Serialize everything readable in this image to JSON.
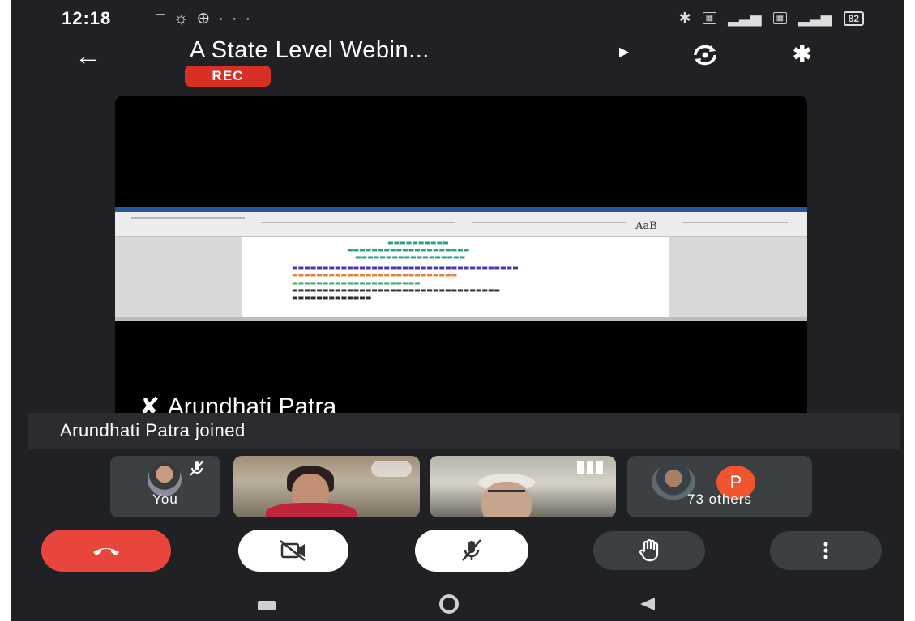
{
  "status_bar": {
    "time": "12:18",
    "battery": "82"
  },
  "header": {
    "title": "A State Level Webin...",
    "rec_label": "REC"
  },
  "video": {
    "speaker_name": "Arundhati Patra"
  },
  "toast": {
    "message": "Arundhati Patra joined"
  },
  "participants": {
    "self_label": "You",
    "others_label": "73 others",
    "others_avatar_letter": "P"
  },
  "controls": {
    "end_call": "end-call",
    "camera": "camera-off",
    "mic": "mic-off",
    "hand": "raise-hand",
    "more": "more-options"
  },
  "colors": {
    "background": "#202124",
    "end_call": "#e8453c",
    "rec": "#d93025",
    "p_avatar": "#f0552f"
  }
}
